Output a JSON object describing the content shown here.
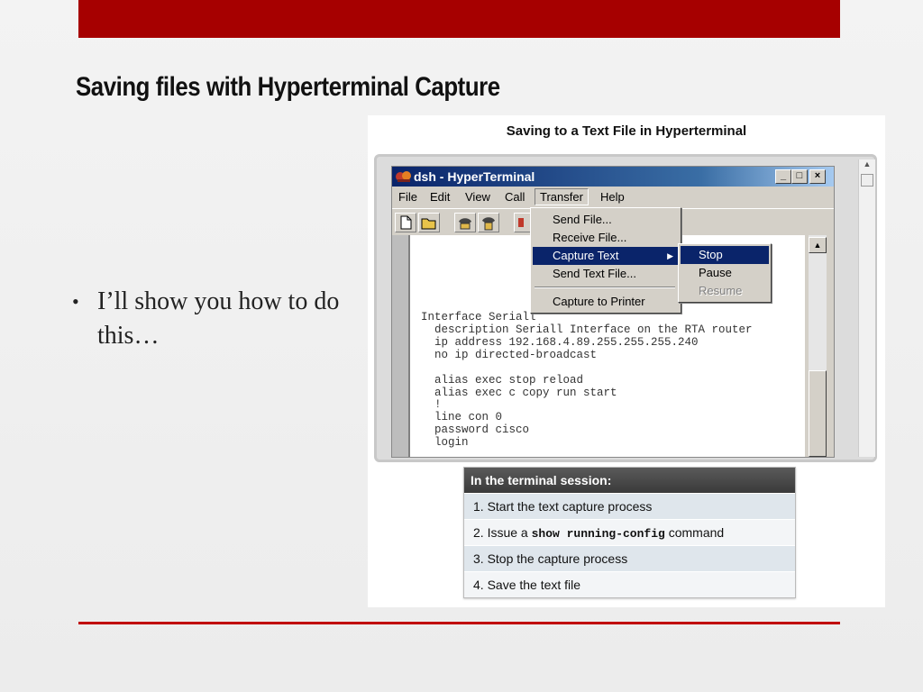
{
  "slide": {
    "title": "Saving files with Hyperterminal Capture",
    "bullet_marker": "•",
    "bullet": "I’ll show you how to do this…",
    "accent_color": "#a60000"
  },
  "figure": {
    "title": "Saving to a Text File in Hyperterminal",
    "window_title": "dsh - HyperTerminal",
    "window_buttons": {
      "minimize": "_",
      "maximize": "□",
      "close": "×"
    },
    "menu": [
      "File",
      "Edit",
      "View",
      "Call",
      "Transfer",
      "Help"
    ],
    "toolbar_icons": [
      "new-connection-icon",
      "open-icon",
      "phone-icon",
      "disconnect-icon",
      "send-icon"
    ],
    "transfer_menu": [
      "Send File...",
      "Receive File...",
      "Capture Text",
      "Send Text File...",
      "Capture to Printer"
    ],
    "submenu_arrow": "▶",
    "capture_submenu": [
      "Stop",
      "Pause",
      "Resume"
    ],
    "scroll_up": "▲",
    "terminal_lines": [
      "Interface Seriall",
      "  description Seriall Interface on the RTA router",
      "  ip address 192.168.4.89.255.255.255.240",
      "  no ip directed-broadcast",
      "",
      "  alias exec stop reload",
      "  alias exec c copy run start",
      "  !",
      "  line con 0",
      "  password cisco",
      "  login"
    ],
    "steps_header": "In the terminal session:",
    "steps": {
      "s1": "1. Start the text capture process",
      "s2_prefix": "2. Issue a ",
      "s2_command": "show running-config",
      "s2_suffix": " command",
      "s3": "3. Stop the capture process",
      "s4": "4. Save the text file"
    }
  }
}
